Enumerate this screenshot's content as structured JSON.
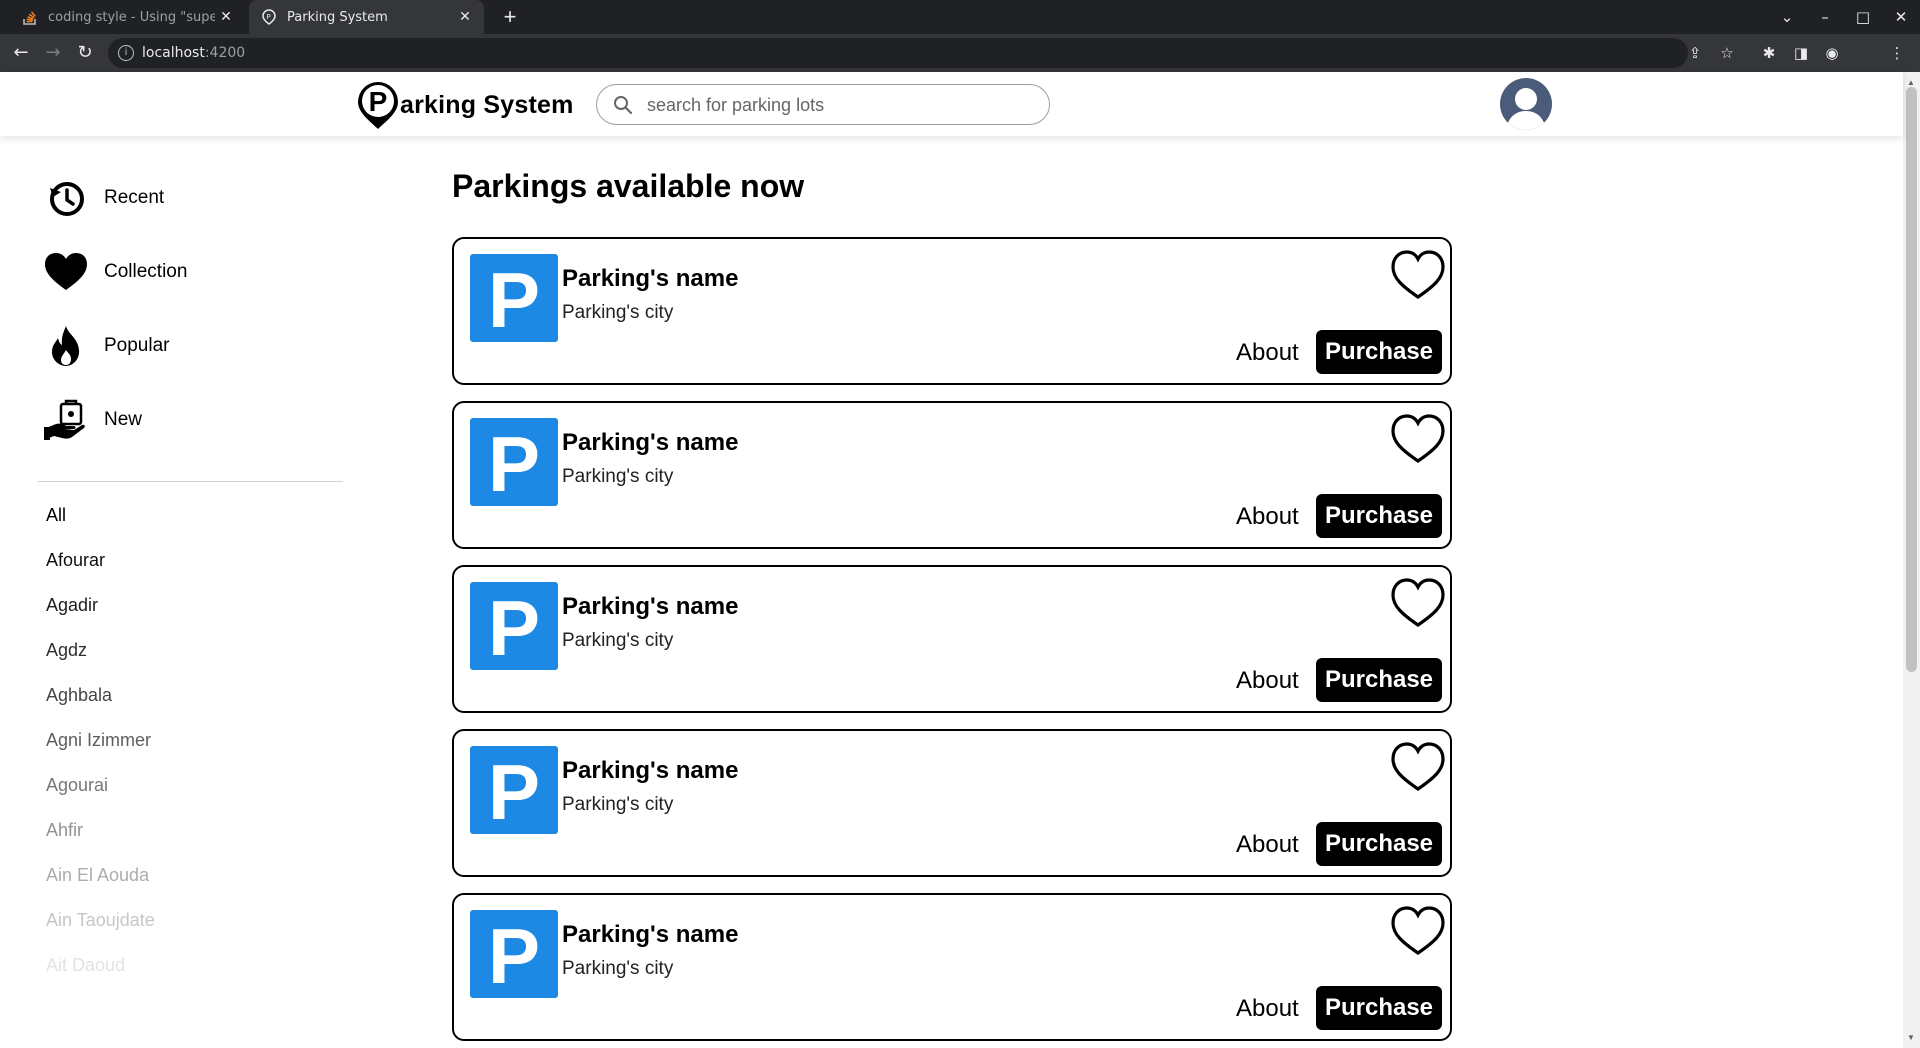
{
  "browser": {
    "tabs": [
      {
        "title": "coding style - Using \"super\" i",
        "favicon": "stackoverflow-icon",
        "active": false
      },
      {
        "title": "Parking System",
        "favicon": "parking-pin-icon",
        "active": true
      }
    ],
    "url_host": "localhost",
    "url_port": ":4200"
  },
  "header": {
    "brand_rest": "arking System",
    "search_placeholder": "search for parking lots",
    "search_value": ""
  },
  "sidebar": {
    "nav": [
      {
        "label": "Recent",
        "icon": "history-icon"
      },
      {
        "label": "Collection",
        "icon": "heart-icon"
      },
      {
        "label": "Popular",
        "icon": "fire-icon"
      },
      {
        "label": "New",
        "icon": "hand-bag-icon"
      }
    ],
    "cities": [
      "All",
      "Afourar",
      "Agadir",
      "Agdz",
      "Aghbala",
      "Agni Izimmer",
      "Agourai",
      "Ahfir",
      "Ain El Aouda",
      "Ain Taoujdate",
      "Ait Daoud"
    ]
  },
  "main": {
    "title": "Parkings available now",
    "cards": [
      {
        "logo_letter": "P",
        "name": "Parking's name",
        "city": "Parking's city",
        "about_label": "About",
        "purchase_label": "Purchase"
      },
      {
        "logo_letter": "P",
        "name": "Parking's name",
        "city": "Parking's city",
        "about_label": "About",
        "purchase_label": "Purchase"
      },
      {
        "logo_letter": "P",
        "name": "Parking's name",
        "city": "Parking's city",
        "about_label": "About",
        "purchase_label": "Purchase"
      },
      {
        "logo_letter": "P",
        "name": "Parking's name",
        "city": "Parking's city",
        "about_label": "About",
        "purchase_label": "Purchase"
      },
      {
        "logo_letter": "P",
        "name": "Parking's name",
        "city": "Parking's city",
        "about_label": "About",
        "purchase_label": "Purchase"
      }
    ]
  },
  "colors": {
    "parking_blue": "#1e88e5",
    "button_black": "#000000",
    "chrome_dark": "#202124"
  }
}
